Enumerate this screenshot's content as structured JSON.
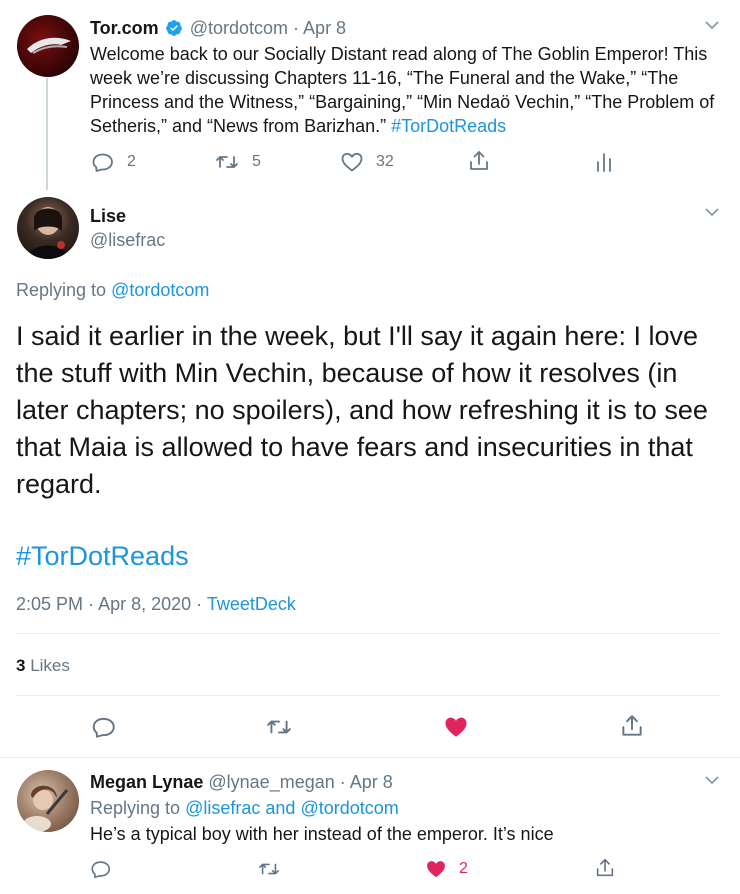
{
  "tweet1": {
    "display_name": "Tor.com",
    "handle": "@tordotcom",
    "sep": "·",
    "date": "Apr 8",
    "text": "Welcome back to our Socially Distant read along of The Goblin Emperor! This week we’re discussing Chapters 11-16, “The Funeral and the Wake,” “The Princess and the Witness,” “Bargaining,” “Min Nedaö Vechin,” “The Problem of Setheris,” and “News from Barizhan.”",
    "hashtag": "#TorDotReads",
    "replies": "2",
    "retweets": "5",
    "likes": "32"
  },
  "main": {
    "display_name": "Lise",
    "handle": "@lisefrac",
    "replying_label": "Replying to",
    "replying_to": "@tordotcom",
    "text": "I said it earlier in the week, but I'll say it again here: I love the stuff with Min Vechin, because of how it resolves (in later chapters; no spoilers), and how refreshing it is to see that Maia is allowed to have fears and insecurities in that regard.",
    "hashtag": "#TorDotReads",
    "time": "2:05 PM",
    "date": "Apr 8, 2020",
    "sep": "·",
    "source": "TweetDeck",
    "likes_count": "3",
    "likes_label": "Likes"
  },
  "reply": {
    "display_name": "Megan Lynae",
    "handle": "@lynae_megan",
    "sep": "·",
    "date": "Apr 8",
    "replying_label": "Replying to",
    "replying_to_1": "@lisefrac",
    "and_label": "and",
    "replying_to_2": "@tordotcom",
    "text": "He’s a typical boy with her instead of the emperor. It’s nice",
    "likes": "2"
  },
  "colors": {
    "link": "#1b95e0",
    "like_active": "#e0245e",
    "muted": "#657786",
    "divider": "#e6ecf0"
  },
  "icons": [
    "chevron-down-icon",
    "reply-icon",
    "retweet-icon",
    "like-icon",
    "share-icon",
    "analytics-icon",
    "verified-badge-icon"
  ]
}
